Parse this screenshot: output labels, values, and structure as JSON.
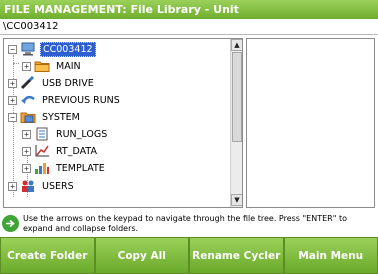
{
  "window": {
    "title": "FILE MANAGEMENT: File Library - Unit"
  },
  "path": {
    "value": "\\CC003412"
  },
  "tree": {
    "root": {
      "label": "CC003412",
      "toggle": "−",
      "icon": "computer-icon"
    },
    "main": {
      "label": "MAIN",
      "toggle": "+",
      "icon": "folder-icon"
    },
    "usb": {
      "label": "USB DRIVE",
      "toggle": "+",
      "icon": "usb-drive-icon"
    },
    "prev_runs": {
      "label": "PREVIOUS RUNS",
      "toggle": "+",
      "icon": "previous-runs-icon"
    },
    "system": {
      "label": "SYSTEM",
      "toggle": "−",
      "icon": "system-folder-icon"
    },
    "run_logs": {
      "label": "RUN_LOGS",
      "toggle": "+",
      "icon": "run-logs-icon"
    },
    "rt_data": {
      "label": "RT_DATA",
      "toggle": "+",
      "icon": "chart-icon"
    },
    "template": {
      "label": "TEMPLATE",
      "toggle": "+",
      "icon": "template-icon"
    },
    "users": {
      "label": "USERS",
      "toggle": "+",
      "icon": "users-icon"
    }
  },
  "scrollbar": {
    "up": "▲",
    "down": "▼"
  },
  "hint": {
    "text": "Use the arrows on the keypad to navigate through the file tree. Press \"ENTER\" to expand and collapse folders.",
    "icon": "navigate-arrows-icon"
  },
  "buttons": {
    "create_folder": "Create Folder",
    "copy_all": "Copy All",
    "rename_cycler": "Rename Cycler",
    "main_menu": "Main Menu"
  },
  "colors": {
    "accent_green": "#7bbb35",
    "selection_blue": "#2d5fd0"
  }
}
